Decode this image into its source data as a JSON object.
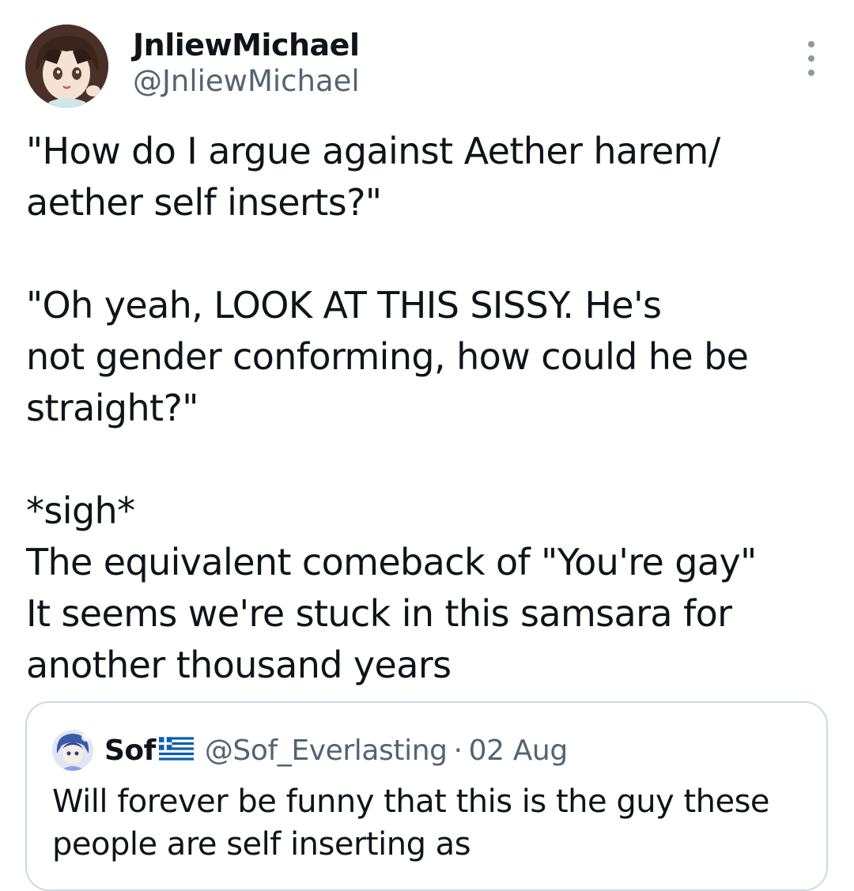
{
  "tweet": {
    "author": {
      "display_name": "JnliewMichael",
      "handle": "@JnliewMichael",
      "avatar_icon": "anime-character-avatar"
    },
    "more_icon": "more-options-vertical-icon",
    "body_lines": [
      "\"How do I argue against Aether harem/",
      "aether self inserts?\"",
      "",
      "\"Oh yeah, LOOK AT THIS SISSY. He's",
      "not gender conforming, how could he be",
      "straight?\"",
      "",
      "*sigh*",
      "The equivalent comeback of \"You're gay\"",
      "It seems we're stuck in this samsara for",
      "another thousand years"
    ]
  },
  "quoted_tweet": {
    "display_name": "Sof",
    "flag_icon": "greece-flag-icon",
    "handle": "@Sof_Everlasting",
    "separator": "·",
    "date": "02 Aug",
    "avatar_icon": "anime-character-avatar",
    "text_lines": [
      "Will forever be funny that this is the guy these",
      "people are self inserting as"
    ]
  },
  "colors": {
    "text_primary": "#0f1419",
    "text_secondary": "#536471",
    "border": "#cfd9de",
    "flag_blue": "#0d5eaf"
  }
}
